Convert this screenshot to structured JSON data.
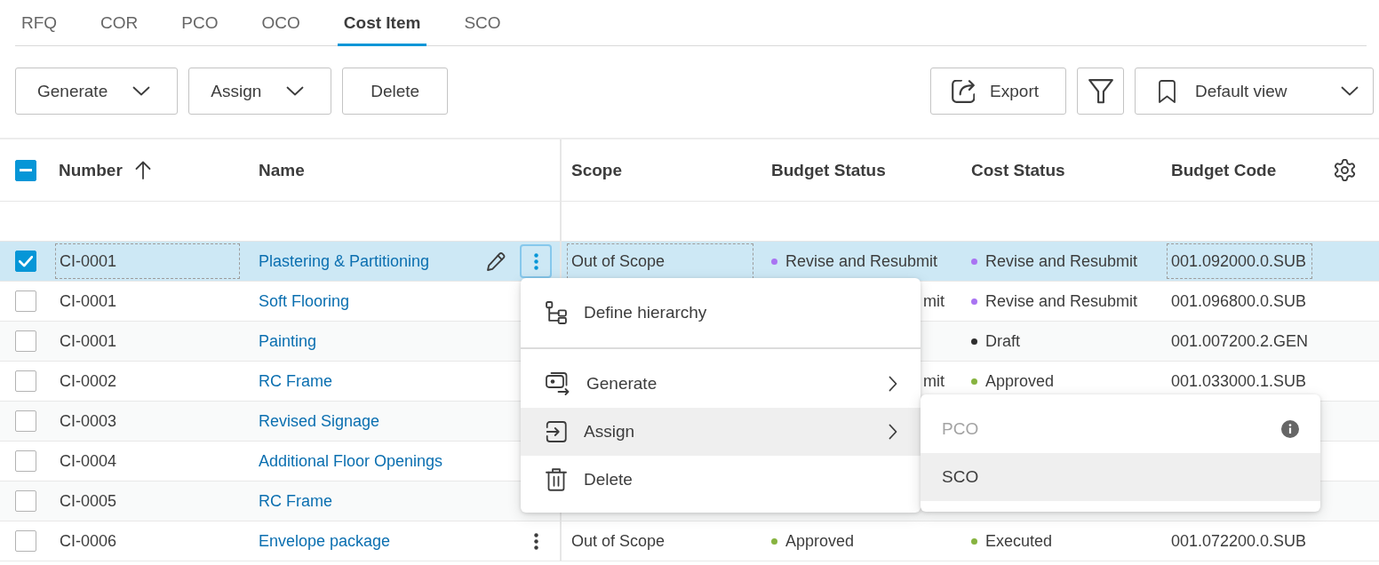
{
  "tabs": [
    {
      "label": "RFQ",
      "selected": false
    },
    {
      "label": "COR",
      "selected": false
    },
    {
      "label": "PCO",
      "selected": false
    },
    {
      "label": "OCO",
      "selected": false
    },
    {
      "label": "Cost Item",
      "selected": true
    },
    {
      "label": "SCO",
      "selected": false
    }
  ],
  "toolbar": {
    "left": [
      {
        "kind": "dropdown",
        "label": "Generate"
      },
      {
        "kind": "dropdown",
        "label": "Assign"
      },
      {
        "kind": "plain",
        "label": "Delete"
      }
    ],
    "right": [
      {
        "kind": "export",
        "label": "Export"
      },
      {
        "kind": "filter"
      },
      {
        "kind": "view",
        "label": "Default view"
      }
    ]
  },
  "table": {
    "select_all": {
      "indeterminate": true
    },
    "columns": [
      {
        "label": "Number",
        "sort_ascending": true
      },
      {
        "label": "Name",
        "sort_ascending": false
      },
      {
        "label": "Scope",
        "sort_ascending": false
      },
      {
        "label": "Budget Status",
        "sort_ascending": false
      },
      {
        "label": "Cost Status",
        "sort_ascending": false
      },
      {
        "label": "Budget Code",
        "sort_ascending": false
      }
    ],
    "rows": [
      {
        "selected": true,
        "checked": true,
        "focused": true,
        "more_button": true,
        "number": "CI-0001",
        "name": "Plastering & Partitioning",
        "scope": "Out of Scope",
        "budget_status": {
          "kind": "status",
          "text": "Revise and Resubmit",
          "color": "#a974f2"
        },
        "cost_status": {
          "kind": "status",
          "text": "Revise and Resubmit",
          "color": "#a974f2"
        },
        "budget_code": "001.092000.0.SUB"
      },
      {
        "selected": false,
        "checked": false,
        "focused": false,
        "number": "CI-0001",
        "name": "Soft Flooring",
        "budget_status": {
          "kind": "fragment",
          "text": "mit"
        },
        "cost_status": {
          "kind": "status",
          "text": "Revise and Resubmit",
          "color": "#a974f2"
        },
        "budget_code": "001.096800.0.SUB"
      },
      {
        "selected": false,
        "checked": false,
        "focused": false,
        "number": "CI-0001",
        "name": "Painting",
        "cost_status": {
          "kind": "status",
          "text": "Draft",
          "color": "#2e2e2e"
        },
        "budget_code": "001.007200.2.GEN"
      },
      {
        "selected": false,
        "checked": false,
        "focused": false,
        "number": "CI-0002",
        "name": "RC Frame",
        "budget_status": {
          "kind": "fragment",
          "text": "mit"
        },
        "cost_status": {
          "kind": "status",
          "text": "Approved",
          "color": "#87b340"
        },
        "budget_code": "001.033000.1.SUB"
      },
      {
        "selected": false,
        "checked": false,
        "focused": false,
        "number": "CI-0003",
        "name": "Revised Signage"
      },
      {
        "selected": false,
        "checked": false,
        "focused": false,
        "number": "CI-0004",
        "name": "Additional Floor Openings"
      },
      {
        "selected": false,
        "checked": false,
        "focused": false,
        "number": "CI-0005",
        "name": "RC Frame"
      },
      {
        "selected": false,
        "checked": false,
        "focused": false,
        "more_button": true,
        "number": "CI-0006",
        "name": "Envelope package",
        "scope": "Out of Scope",
        "budget_status": {
          "kind": "status",
          "text": "Approved",
          "color": "#87b340"
        },
        "cost_status": {
          "kind": "status",
          "text": "Executed",
          "color": "#87b340"
        },
        "budget_code": "001.072200.0.SUB"
      }
    ]
  },
  "context_menu": {
    "groups": [
      [
        {
          "kind": "hierarchy",
          "label": "Define hierarchy",
          "submenu": false,
          "highlighted": false
        }
      ],
      [
        {
          "kind": "generate",
          "label": "Generate",
          "submenu": true,
          "highlighted": false
        },
        {
          "kind": "assign",
          "label": "Assign",
          "submenu": true,
          "highlighted": true
        },
        {
          "kind": "delete",
          "label": "Delete",
          "submenu": false,
          "highlighted": false
        }
      ]
    ]
  },
  "submenu": {
    "items": [
      {
        "label": "PCO",
        "disabled": true,
        "info": true,
        "highlighted": false
      },
      {
        "label": "SCO",
        "disabled": false,
        "info": false,
        "highlighted": true
      }
    ]
  }
}
